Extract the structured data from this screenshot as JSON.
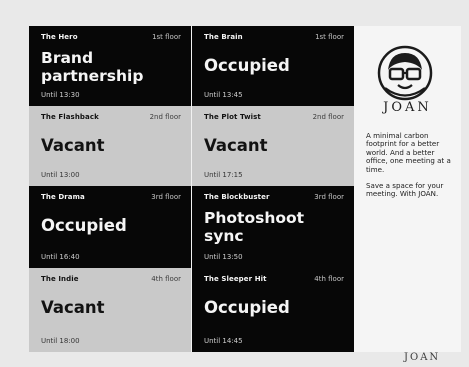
{
  "rooms": [
    {
      "name": "The Hero",
      "floor": "1st floor",
      "status": "Brand partnership",
      "until": "Until 13:30",
      "theme": "dark"
    },
    {
      "name": "The Brain",
      "floor": "1st floor",
      "status": "Occupied",
      "until": "Until 13:45",
      "theme": "dark"
    },
    {
      "name": "The Flashback",
      "floor": "2nd floor",
      "status": "Vacant",
      "until": "Until 13:00",
      "theme": "light"
    },
    {
      "name": "The Plot Twist",
      "floor": "2nd floor",
      "status": "Vacant",
      "until": "Until 17:15",
      "theme": "light"
    },
    {
      "name": "The Drama",
      "floor": "3rd floor",
      "status": "Occupied",
      "until": "Until 16:40",
      "theme": "dark"
    },
    {
      "name": "The Blockbuster",
      "floor": "3rd floor",
      "status": "Photoshoot sync",
      "until": "Until 13:50",
      "theme": "dark"
    },
    {
      "name": "The Indie",
      "floor": "4th floor",
      "status": "Vacant",
      "until": "Until 18:00",
      "theme": "light"
    },
    {
      "name": "The Sleeper Hit",
      "floor": "4th floor",
      "status": "Occupied",
      "until": "Until 14:45",
      "theme": "dark"
    }
  ],
  "side": {
    "brand": "JOAN",
    "desc1": "A minimal carbon footprint for a better world. And a better office, one meeting at a time.",
    "desc2": "Save a space for your meeting. With JOAN.",
    "logo_icon": "joan-character-icon"
  },
  "footer_brand": "JOAN",
  "colors": {
    "dark": "#070707",
    "light": "#c9c9c9",
    "panel": "#f5f5f5"
  }
}
